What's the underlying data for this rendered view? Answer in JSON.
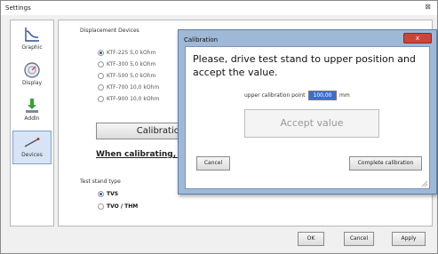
{
  "window": {
    "title": "Settings",
    "close": "⊠"
  },
  "sidebar": {
    "items": [
      {
        "label": "Graphic",
        "icon": "graphic-curve-icon"
      },
      {
        "label": "Display",
        "icon": "display-gauge-icon"
      },
      {
        "label": "AddIn",
        "icon": "addin-download-icon"
      },
      {
        "label": "Devices",
        "icon": "devices-probe-icon",
        "selected": true
      }
    ]
  },
  "content": {
    "displacement_title": "Displacement Devices",
    "devices": [
      {
        "label": "KTF-225  5,0 kOhm",
        "selected": true
      },
      {
        "label": "KTF-300  5,0 kOhm",
        "selected": false
      },
      {
        "label": "KTF-500  5,0 kOhm",
        "selected": false
      },
      {
        "label": "KTF-700  10,0 kOhm",
        "selected": false
      },
      {
        "label": "KTF-900  10,0 kOhm",
        "selected": false
      }
    ],
    "calibration_button": "Calibration",
    "warning": "When calibrating, ple",
    "test_stand_title": "Test stand type",
    "stands": [
      {
        "label": "TVS",
        "selected": true
      },
      {
        "label": "TVO / THM",
        "selected": false
      }
    ]
  },
  "footer": {
    "ok": "OK",
    "cancel": "Cancel",
    "apply": "Apply"
  },
  "dialog": {
    "title": "Calibration",
    "close": "x",
    "message": "Please, drive test stand to upper position and accept the value.",
    "upper_label": "upper calibration point",
    "upper_value": "100,00",
    "unit": "mm",
    "accept": "Accept value",
    "cancel": "Cancel",
    "complete": "Complete calibration"
  },
  "colors": {
    "accent": "#3a6fd0",
    "dialog_frame": "#9fb8d6",
    "close_red": "#c9463d",
    "selected_sidebar": "#d7e4f5"
  }
}
